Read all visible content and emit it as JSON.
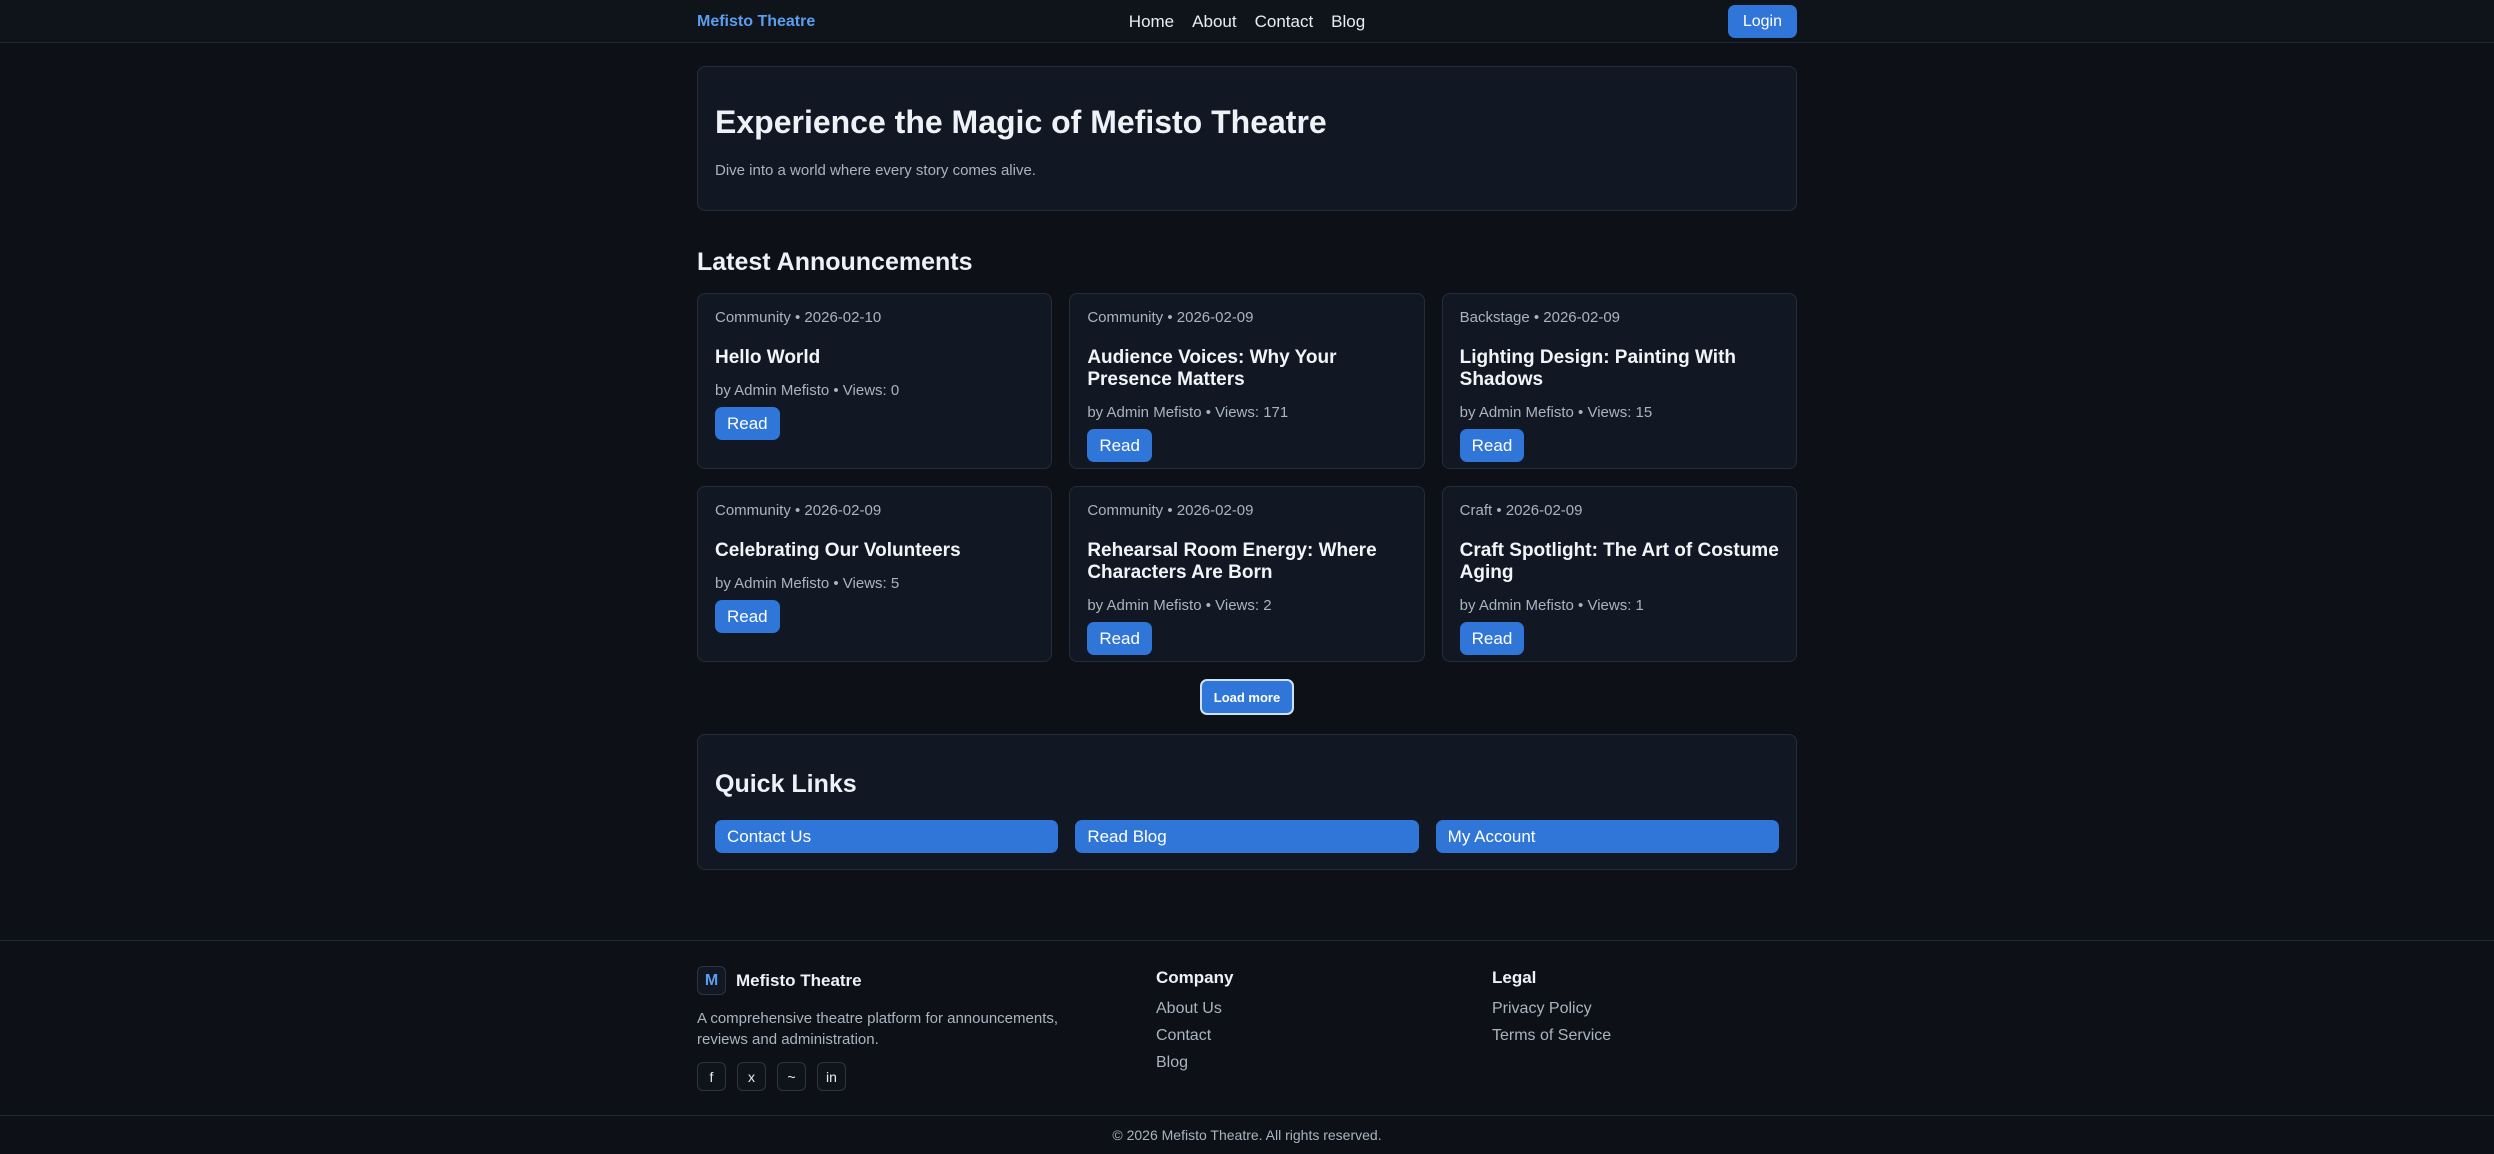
{
  "nav": {
    "brand": "Mefisto Theatre",
    "links": [
      "Home",
      "About",
      "Contact",
      "Blog"
    ],
    "login_label": "Login"
  },
  "hero": {
    "title": "Experience the Magic of Mefisto Theatre",
    "subtitle": "Dive into a world where every story comes alive."
  },
  "announcements": {
    "title": "Latest Announcements",
    "read_label": "Read",
    "items": [
      {
        "meta": "Community • 2026-02-10",
        "title": "Hello World",
        "byline": "by Admin Mefisto • Views: 0"
      },
      {
        "meta": "Community • 2026-02-09",
        "title": "Audience Voices: Why Your Presence Matters",
        "byline": "by Admin Mefisto • Views: 171"
      },
      {
        "meta": "Backstage • 2026-02-09",
        "title": "Lighting Design: Painting With Shadows",
        "byline": "by Admin Mefisto • Views: 15"
      },
      {
        "meta": "Community • 2026-02-09",
        "title": "Celebrating Our Volunteers",
        "byline": "by Admin Mefisto • Views: 5"
      },
      {
        "meta": "Community • 2026-02-09",
        "title": "Rehearsal Room Energy: Where Characters Are Born",
        "byline": "by Admin Mefisto • Views: 2"
      },
      {
        "meta": "Craft • 2026-02-09",
        "title": "Craft Spotlight: The Art of Costume Aging",
        "byline": "by Admin Mefisto • Views: 1"
      }
    ],
    "load_more_label": "Load more"
  },
  "quick_links": {
    "title": "Quick Links",
    "items": [
      "Contact Us",
      "Read Blog",
      "My Account"
    ]
  },
  "footer": {
    "logo_letter": "M",
    "brand": "Mefisto Theatre",
    "description": "A comprehensive theatre platform for announcements, reviews and administration.",
    "socials": [
      {
        "icon": "facebook-icon",
        "glyph": "f"
      },
      {
        "icon": "x-icon",
        "glyph": "x"
      },
      {
        "icon": "tilde-icon",
        "glyph": "~"
      },
      {
        "icon": "linkedin-icon",
        "glyph": "in"
      }
    ],
    "company": {
      "heading": "Company",
      "links": [
        "About Us",
        "Contact",
        "Blog"
      ]
    },
    "legal": {
      "heading": "Legal",
      "links": [
        "Privacy Policy",
        "Terms of Service"
      ]
    },
    "copyright": "© 2026 Mefisto Theatre. All rights reserved."
  },
  "colors": {
    "background": "#0d1117",
    "card": "#111823",
    "accent": "#2f76d8",
    "brand": "#5b9dee",
    "muted_text": "#a9b4c1"
  }
}
